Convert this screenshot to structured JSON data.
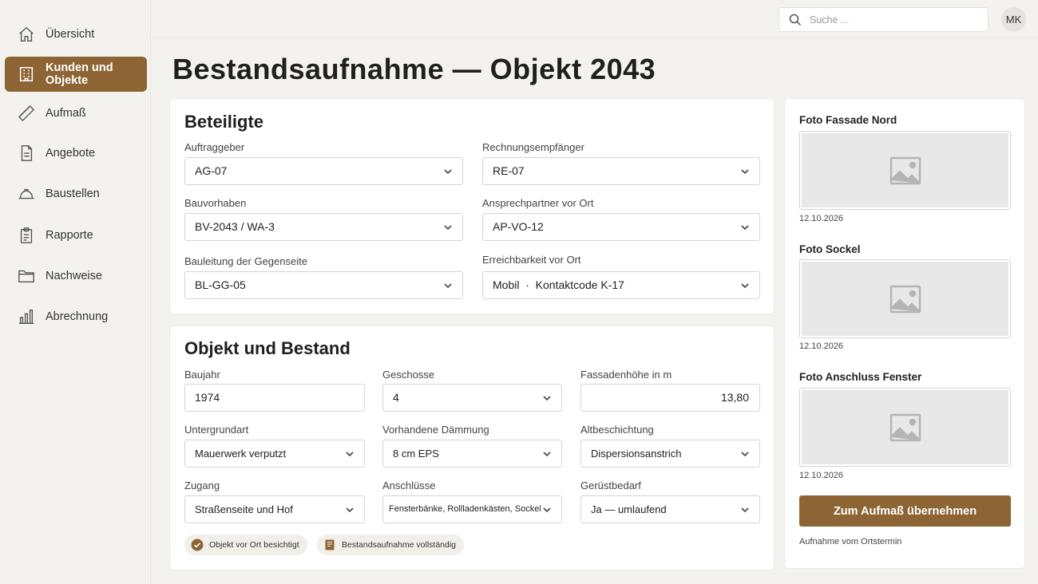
{
  "sidebar": {
    "items": [
      {
        "label": "Übersicht",
        "icon": "home-icon"
      },
      {
        "label": "Kunden und Objekte",
        "icon": "building-icon",
        "active": true
      },
      {
        "label": "Aufmaß",
        "icon": "ruler-icon"
      },
      {
        "label": "Angebote",
        "icon": "document-icon"
      },
      {
        "label": "Baustellen",
        "icon": "hardhat-icon"
      },
      {
        "label": "Rapporte",
        "icon": "clipboard-icon"
      },
      {
        "label": "Nachweise",
        "icon": "folder-icon"
      },
      {
        "label": "Abrechnung",
        "icon": "bar-chart-icon"
      }
    ]
  },
  "header": {
    "search_placeholder": "Suche ...",
    "avatar_initials": "MK"
  },
  "page": {
    "title": "Bestandsaufnahme — Objekt 2043"
  },
  "beteiligte": {
    "title": "Beteiligte",
    "auftraggeber": {
      "label": "Auftraggeber",
      "value": "AG-07"
    },
    "rechnungsempfaenger": {
      "label": "Rechnungsempfänger",
      "value": "RE-07"
    },
    "bauvorhaben": {
      "label": "Bauvorhaben",
      "value": "BV-2043 / WA-3"
    },
    "ansprechpartner": {
      "label": "Ansprechpartner vor Ort",
      "value": "AP-VO-12"
    },
    "bauleitung": {
      "label": "Bauleitung der Gegenseite",
      "value": "BL-GG-05"
    },
    "erreichbarkeit": {
      "label": "Erreichbarkeit vor Ort",
      "value": "Mobil  ·  Kontaktcode K-17"
    }
  },
  "objekt": {
    "title": "Objekt und Bestand",
    "baujahr": {
      "label": "Baujahr",
      "value": "1974"
    },
    "geschosse": {
      "label": "Geschosse",
      "value": "4"
    },
    "fassadenhoehe": {
      "label": "Fassadenhöhe in m",
      "value": "13,80"
    },
    "untergrundart": {
      "label": "Untergrundart",
      "value": "Mauerwerk verputzt"
    },
    "daemmung": {
      "label": "Vorhandene Dämmung",
      "value": "8 cm EPS"
    },
    "altbeschichtung": {
      "label": "Altbeschichtung",
      "value": "Dispersionsanstrich"
    },
    "zugang": {
      "label": "Zugang",
      "value": "Straßenseite und Hof"
    },
    "anschluesse": {
      "label": "Anschlüsse",
      "value": "Fensterbänke, Rollladenkästen, Sockel"
    },
    "geruestbedarf": {
      "label": "Gerüstbedarf",
      "value": "Ja — umlaufend"
    },
    "badges": [
      {
        "label": "Objekt vor Ort besichtigt",
        "icon": "check-circle-icon"
      },
      {
        "label": "Bestandsaufnahme vollständig",
        "icon": "book-icon"
      }
    ]
  },
  "photos": [
    {
      "title": "Foto Fassade Nord",
      "date": "12.10.2026"
    },
    {
      "title": "Foto Sockel",
      "date": "12.10.2026"
    },
    {
      "title": "Foto Anschluss Fenster",
      "date": "12.10.2026"
    }
  ],
  "actions": {
    "primary_label": "Zum Aufmaß übernehmen",
    "note": "Aufnahme vom Ortstermin"
  },
  "colors": {
    "accent": "#8d6534",
    "background": "#f3f2ef",
    "card": "#ffffff"
  }
}
